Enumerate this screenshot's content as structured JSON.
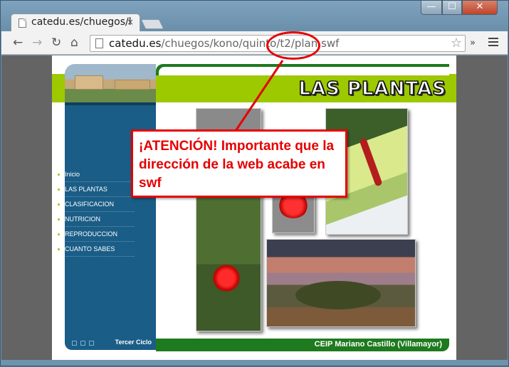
{
  "browser": {
    "tab_title": "catedu.es/chuegos/k",
    "tab_close": "×",
    "url_host": "catedu.es",
    "url_path": "/chuegos/kono/quinto/t2/plan.swf",
    "window_controls": {
      "minimize": "—",
      "maximize": "☐",
      "close": "✕"
    },
    "nav": {
      "back": "←",
      "forward": "→",
      "reload": "↻",
      "home": "⌂"
    },
    "star": "☆",
    "overflow": "»"
  },
  "page": {
    "title": "LAS PLANTAS",
    "nav_items": [
      "Inicio",
      "LAS PLANTAS",
      "CLASIFICACION",
      "NUTRICION",
      "REPRODUCCION",
      "CUANTO SABES"
    ],
    "footer_left": "Tercer Ciclo",
    "footer_right": "CEIP Mariano Castillo (Villamayor)"
  },
  "annotation": {
    "text": "¡ATENCIÓN! Importante que la dirección de la web acabe en swf",
    "color": "#e60000"
  },
  "colors": {
    "header_green": "#9cc900",
    "dark_green": "#1e7a1e",
    "side_blue": "#1a5d86"
  }
}
